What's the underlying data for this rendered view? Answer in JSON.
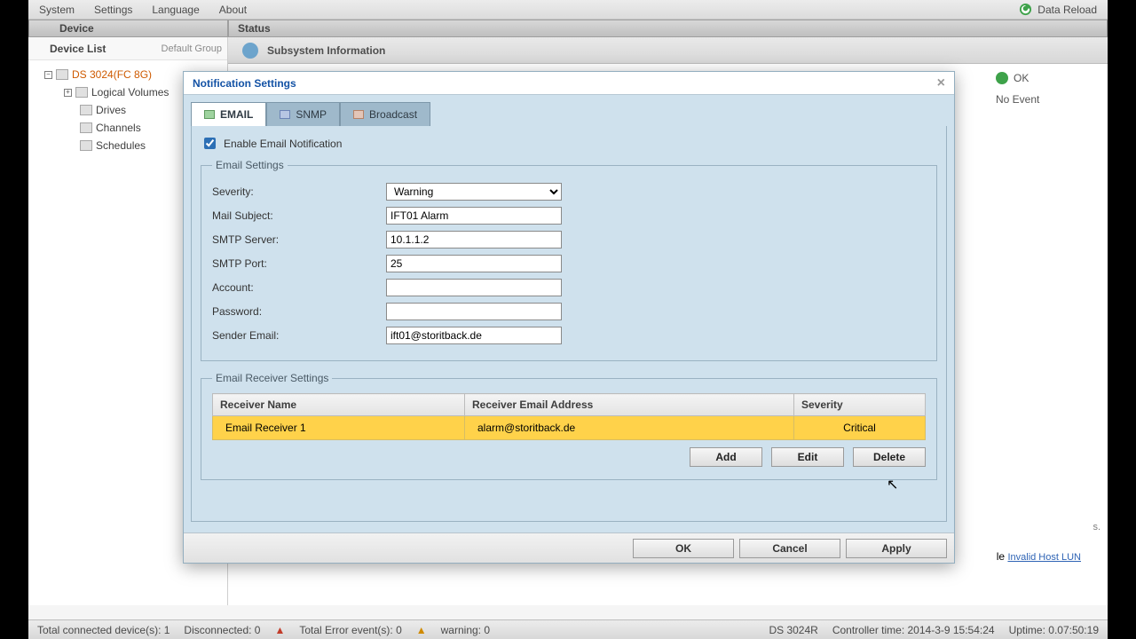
{
  "menu": {
    "system": "System",
    "settings": "Settings",
    "language": "Language",
    "about": "About",
    "reload": "Data Reload"
  },
  "cols": {
    "device": "Device",
    "status": "Status"
  },
  "tree": {
    "title": "Device List",
    "group": "Default Group",
    "root": "DS 3024(FC 8G)",
    "n1": "Logical Volumes",
    "n2": "Drives",
    "n3": "Channels",
    "n4": "Schedules"
  },
  "sub": {
    "title": "Subsystem Information",
    "ok": "OK",
    "noevent": "No Event",
    "notesuffix": "s.",
    "link": "Invalid Host LUN",
    "linktail": "le "
  },
  "dialog": {
    "title": "Notification Settings",
    "tabs": {
      "email": "EMAIL",
      "snmp": "SNMP",
      "broadcast": "Broadcast"
    },
    "enable": "Enable Email Notification",
    "fs1": "Email Settings",
    "labels": {
      "severity": "Severity:",
      "subject": "Mail Subject:",
      "smtp": "SMTP Server:",
      "port": "SMTP Port:",
      "account": "Account:",
      "password": "Password:",
      "sender": "Sender Email:"
    },
    "values": {
      "severity": "Warning",
      "subject": "IFT01 Alarm",
      "smtp": "10.1.1.2",
      "port": "25",
      "account": "",
      "password": "",
      "sender": "ift01@storitback.de"
    },
    "fs2": "Email Receiver Settings",
    "cols": {
      "name": "Receiver Name",
      "email": "Receiver Email Address",
      "sev": "Severity"
    },
    "row": {
      "name": "Email Receiver 1",
      "email": "alarm@storitback.de",
      "sev": "Critical"
    },
    "btns": {
      "add": "Add",
      "edit": "Edit",
      "del": "Delete"
    },
    "foot": {
      "ok": "OK",
      "cancel": "Cancel",
      "apply": "Apply"
    }
  },
  "statusbar": {
    "conn": "Total connected device(s): 1",
    "disc": "Disconnected: 0",
    "err": "Total Error event(s): 0",
    "warn": "warning: 0",
    "model": "DS 3024R",
    "ctime": "Controller time: 2014-3-9 15:54:24",
    "uptime": "Uptime: 0.07:50:19"
  }
}
